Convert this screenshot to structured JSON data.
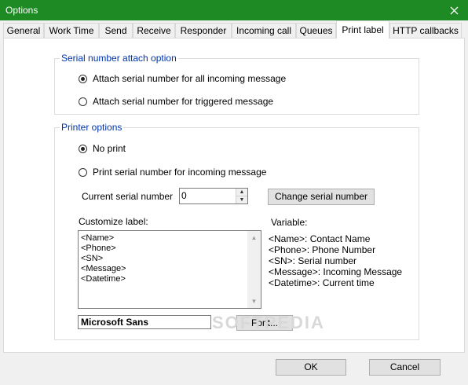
{
  "window": {
    "title": "Options"
  },
  "tabs": [
    {
      "label": "General"
    },
    {
      "label": "Work Time"
    },
    {
      "label": "Send"
    },
    {
      "label": "Receive"
    },
    {
      "label": "Responder"
    },
    {
      "label": "Incoming call"
    },
    {
      "label": "Queues"
    },
    {
      "label": "Print label"
    },
    {
      "label": "HTTP callbacks"
    }
  ],
  "active_tab": "Print label",
  "serial_group": {
    "title": "Serial number attach option",
    "options": [
      {
        "label": "Attach serial number for all incoming message",
        "checked": true
      },
      {
        "label": "Attach serial number for triggered message",
        "checked": false
      }
    ]
  },
  "printer_group": {
    "title": "Printer options",
    "options": [
      {
        "label": "No print",
        "checked": true
      },
      {
        "label": "Print serial number for incoming message",
        "checked": false
      }
    ],
    "current_serial_label": "Current serial number",
    "current_serial_value": "0",
    "change_serial_button": "Change serial number",
    "customize_label": "Customize label:",
    "label_lines": [
      "<Name>",
      "<Phone>",
      "<SN>",
      "<Message>",
      "<Datetime>"
    ],
    "variable_title": "Variable:",
    "variables": [
      "<Name>: Contact Name",
      "<Phone>: Phone Number",
      "<SN>: Serial number",
      "<Message>: Incoming Message",
      "<Datetime>: Current time"
    ],
    "font_name": "Microsoft Sans",
    "font_button": "Font..."
  },
  "footer": {
    "ok": "OK",
    "cancel": "Cancel"
  },
  "watermark": "SOFTPEDIA",
  "colors": {
    "titlebar": "#1e8a24",
    "group_title": "#0033aa"
  }
}
